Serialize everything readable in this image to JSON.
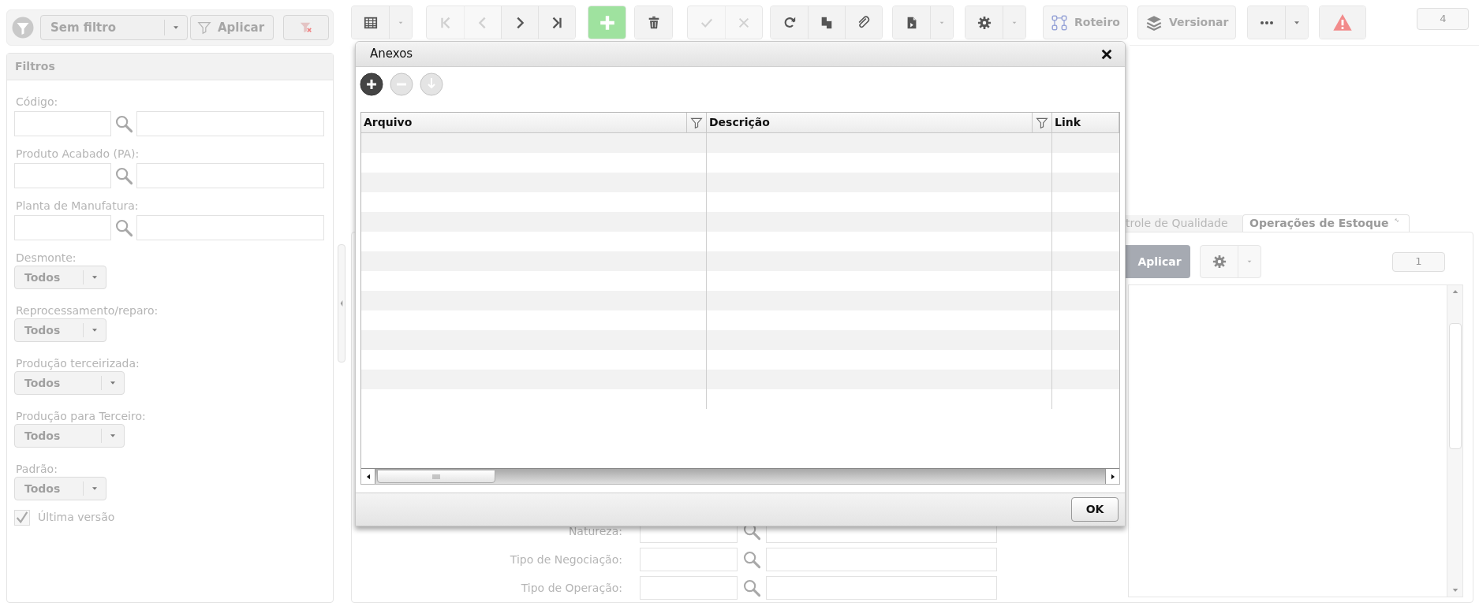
{
  "filter_bar": {
    "filter_select": "Sem filtro",
    "apply_button": "Aplicar"
  },
  "filters_panel": {
    "title": "Filtros",
    "lookups": [
      {
        "label": "Código:"
      },
      {
        "label": "Produto Acabado (PA):"
      },
      {
        "label": "Planta de Manufatura:"
      }
    ],
    "selects": [
      {
        "label": "Desmonte:",
        "value": "Todos",
        "wide": false
      },
      {
        "label": "Reprocessamento/reparo:",
        "value": "Todos",
        "wide": false
      },
      {
        "label": "Produção terceirizada:",
        "value": "Todos",
        "wide": true
      },
      {
        "label": "Produção para Terceiro:",
        "value": "Todos",
        "wide": true
      },
      {
        "label": "Padrão:",
        "value": "Todos",
        "wide": false
      }
    ],
    "checkbox": {
      "label": "Última versão",
      "checked": true
    }
  },
  "toolbar": {
    "groups": [
      {
        "items": [
          {
            "kind": "grid",
            "disabled": false
          },
          {
            "kind": "caret",
            "disabled": false
          }
        ]
      },
      {
        "items": [
          {
            "kind": "first",
            "disabled": true
          },
          {
            "kind": "prev",
            "disabled": true
          },
          {
            "kind": "next",
            "disabled": false
          },
          {
            "kind": "last",
            "disabled": false
          }
        ]
      },
      {
        "items": [
          {
            "kind": "add",
            "disabled": false
          }
        ]
      },
      {
        "items": [
          {
            "kind": "delete",
            "disabled": false
          }
        ]
      },
      {
        "items": [
          {
            "kind": "confirm",
            "disabled": true
          },
          {
            "kind": "cancel",
            "disabled": true
          }
        ]
      },
      {
        "items": [
          {
            "kind": "refresh",
            "disabled": false
          },
          {
            "kind": "copy",
            "disabled": false
          },
          {
            "kind": "attach",
            "disabled": false
          }
        ]
      },
      {
        "items": [
          {
            "kind": "document",
            "disabled": false
          },
          {
            "kind": "caret",
            "disabled": false
          }
        ]
      },
      {
        "items": [
          {
            "kind": "settings",
            "disabled": false
          },
          {
            "kind": "caret",
            "disabled": false
          }
        ]
      },
      {
        "items": [
          {
            "kind": "route",
            "label": "Roteiro",
            "disabled": false
          }
        ]
      },
      {
        "items": [
          {
            "kind": "versions",
            "label": "Versionar",
            "disabled": false
          }
        ]
      },
      {
        "items": [
          {
            "kind": "more",
            "disabled": false
          },
          {
            "kind": "caret-dark",
            "disabled": false
          }
        ]
      },
      {
        "items": [
          {
            "kind": "alert",
            "disabled": false
          }
        ]
      }
    ],
    "badge": "4"
  },
  "background_panel": {
    "tabs": [
      {
        "label": "trole de Qualidade",
        "selected": false
      },
      {
        "label": "Operações de Estoque",
        "selected": true
      }
    ],
    "apply_button": "Aplicar",
    "badge": "1",
    "form_fields": [
      {
        "label": "Natureza:"
      },
      {
        "label": "Tipo de Negociação:"
      },
      {
        "label": "Tipo de Operação:"
      }
    ]
  },
  "dialog": {
    "title": "Anexos",
    "toolbar": [
      {
        "kind": "add",
        "disabled": false
      },
      {
        "kind": "remove",
        "disabled": true
      },
      {
        "kind": "download",
        "disabled": true
      }
    ],
    "columns": [
      {
        "label": "Arquivo",
        "filterable": true
      },
      {
        "label": "Descrição",
        "filterable": true
      },
      {
        "label": "Link",
        "filterable": false
      }
    ],
    "ok_button": "OK"
  }
}
